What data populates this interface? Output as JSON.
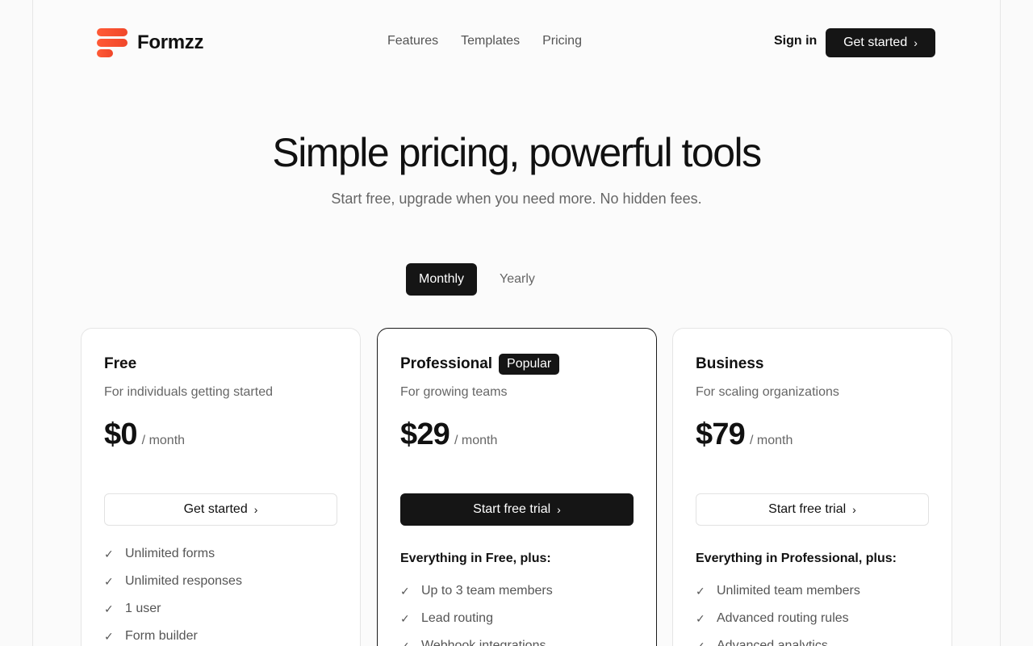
{
  "brand": {
    "name": "Formzz",
    "accent": "#f0472a"
  },
  "nav": {
    "items": [
      "Features",
      "Templates",
      "Pricing"
    ],
    "signin": "Sign in",
    "cta": "Get started"
  },
  "hero": {
    "title": "Simple pricing, powerful tools",
    "subtitle": "Start free, upgrade when you need more. No hidden fees."
  },
  "billing": {
    "monthly": "Monthly",
    "yearly": "Yearly",
    "selected": "Monthly"
  },
  "plans": [
    {
      "name": "Free",
      "desc": "For individuals getting started",
      "price": "$0",
      "period": "/ month",
      "button": "Get started",
      "features_head": "",
      "features": [
        "Unlimited forms",
        "Unlimited responses",
        "1 user",
        "Form builder"
      ]
    },
    {
      "name": "Professional",
      "badge": "Popular",
      "desc": "For growing teams",
      "price": "$29",
      "period": "/ month",
      "button": "Start free trial",
      "features_head": "Everything in Free, plus:",
      "features": [
        "Up to 3 team members",
        "Lead routing",
        "Webhook integrations"
      ]
    },
    {
      "name": "Business",
      "desc": "For scaling organizations",
      "price": "$79",
      "period": "/ month",
      "button": "Start free trial",
      "features_head": "Everything in Professional, plus:",
      "features": [
        "Unlimited team members",
        "Advanced routing rules",
        "Advanced analytics"
      ]
    }
  ]
}
